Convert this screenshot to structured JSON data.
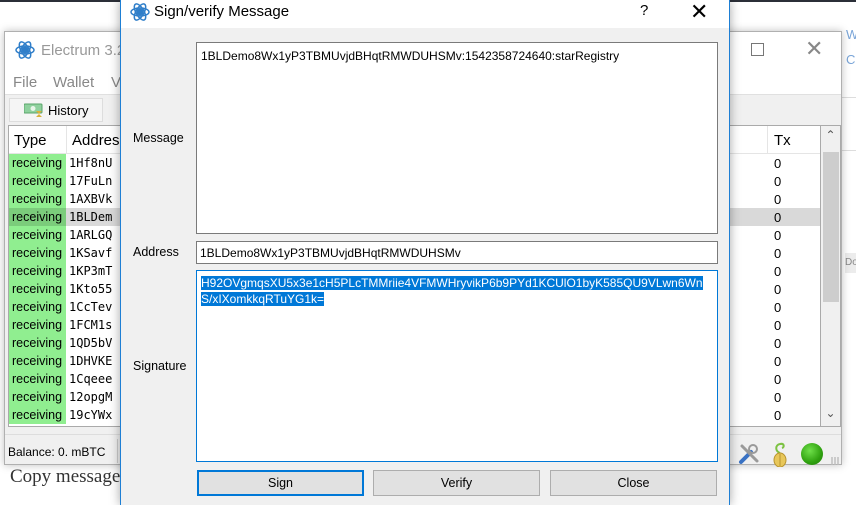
{
  "background_page": {
    "text": "Copy message",
    "right_edge_fragments": [
      "W",
      "C",
      "Do"
    ]
  },
  "electrum_window": {
    "title": "Electrum 3.2",
    "menu": [
      "File",
      "Wallet",
      "V"
    ],
    "tabs": [
      {
        "label": "History",
        "icon": "history-icon"
      }
    ],
    "table": {
      "columns": [
        "Type",
        "Address",
        "Tx"
      ],
      "rows": [
        {
          "type": "receiving",
          "address": "1Hf8nU",
          "tx": "0",
          "selected": false
        },
        {
          "type": "receiving",
          "address": "17FuLn",
          "tx": "0",
          "selected": false
        },
        {
          "type": "receiving",
          "address": "1AXBVk",
          "tx": "0",
          "selected": false
        },
        {
          "type": "receiving",
          "address": "1BLDem",
          "tx": "0",
          "selected": true
        },
        {
          "type": "receiving",
          "address": "1ARLGQ",
          "tx": "0",
          "selected": false
        },
        {
          "type": "receiving",
          "address": "1KSavf",
          "tx": "0",
          "selected": false
        },
        {
          "type": "receiving",
          "address": "1KP3mT",
          "tx": "0",
          "selected": false
        },
        {
          "type": "receiving",
          "address": "1Kto55",
          "tx": "0",
          "selected": false
        },
        {
          "type": "receiving",
          "address": "1CcTev",
          "tx": "0",
          "selected": false
        },
        {
          "type": "receiving",
          "address": "1FCM1s",
          "tx": "0",
          "selected": false
        },
        {
          "type": "receiving",
          "address": "1QD5bV",
          "tx": "0",
          "selected": false
        },
        {
          "type": "receiving",
          "address": "1DHVKE",
          "tx": "0",
          "selected": false
        },
        {
          "type": "receiving",
          "address": "1Cqeee",
          "tx": "0",
          "selected": false
        },
        {
          "type": "receiving",
          "address": "12opgM",
          "tx": "0",
          "selected": false
        },
        {
          "type": "receiving",
          "address": "19cYWx",
          "tx": "0",
          "selected": false
        }
      ]
    },
    "status": {
      "balance": "Balance: 0. mBTC",
      "icons": [
        "preferences-icon",
        "seed-icon",
        "network-status-icon"
      ]
    },
    "colors": {
      "receiving": "#90ee90",
      "selected_row": "#d9d9d9"
    }
  },
  "dialog": {
    "title": "Sign/verify Message",
    "help_label": "?",
    "close_label": "✕",
    "labels": {
      "message": "Message",
      "address": "Address",
      "signature": "Signature"
    },
    "message_value": "1BLDemo8Wx1yP3TBMUvjdBHqtRMWDUHSMv:1542358724640:starRegistry",
    "address_value": "1BLDemo8Wx1yP3TBMUvjdBHqtRMWDUHSMv",
    "signature_value": "H92OVgmqsXU5x3e1cH5PLcTMMriie4VFMWHryvikP6b9PYd1KCUlO1byK585QU9VLwn6WnS/xIXomkkqRTuYG1k=",
    "buttons": {
      "sign": "Sign",
      "verify": "Verify",
      "close": "Close"
    },
    "colors": {
      "accent": "#0078d7"
    }
  }
}
